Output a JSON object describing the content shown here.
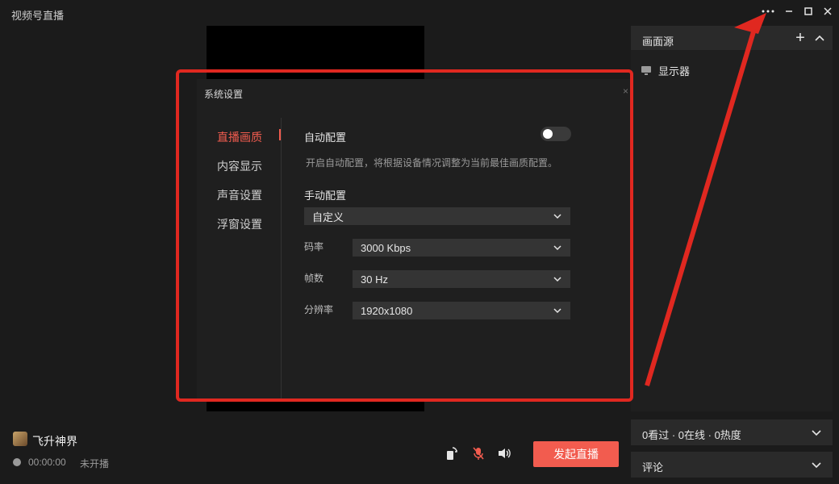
{
  "app": {
    "title": "视频号直播"
  },
  "dialog": {
    "title": "系统设置",
    "close_glyph": "×",
    "nav": [
      {
        "label": "直播画质",
        "active": true
      },
      {
        "label": "内容显示",
        "active": false
      },
      {
        "label": "声音设置",
        "active": false
      },
      {
        "label": "浮窗设置",
        "active": false
      }
    ],
    "auto_config": {
      "label": "自动配置",
      "enabled": false,
      "hint": "开启自动配置，将根据设备情况调整为当前最佳画质配置。"
    },
    "manual_config": {
      "label": "手动配置",
      "preset": "自定义",
      "fields": [
        {
          "label": "码率",
          "value": "3000 Kbps"
        },
        {
          "label": "帧数",
          "value": "30 Hz"
        },
        {
          "label": "分辨率",
          "value": "1920x1080"
        }
      ]
    }
  },
  "sources": {
    "title": "画面源",
    "add_glyph": "+",
    "items": [
      {
        "label": "显示器",
        "icon": "monitor-icon"
      }
    ]
  },
  "stats": {
    "text": "0看过 · 0在线 · 0热度"
  },
  "comments": {
    "label": "评论"
  },
  "user": {
    "name": "飞升神界",
    "timer": "00:00:00",
    "status": "未开播"
  },
  "actions": {
    "start_label": "发起直播"
  },
  "colors": {
    "accent": "#f25c4f",
    "annotation": "#e02820",
    "background": "#1b1b1b"
  }
}
